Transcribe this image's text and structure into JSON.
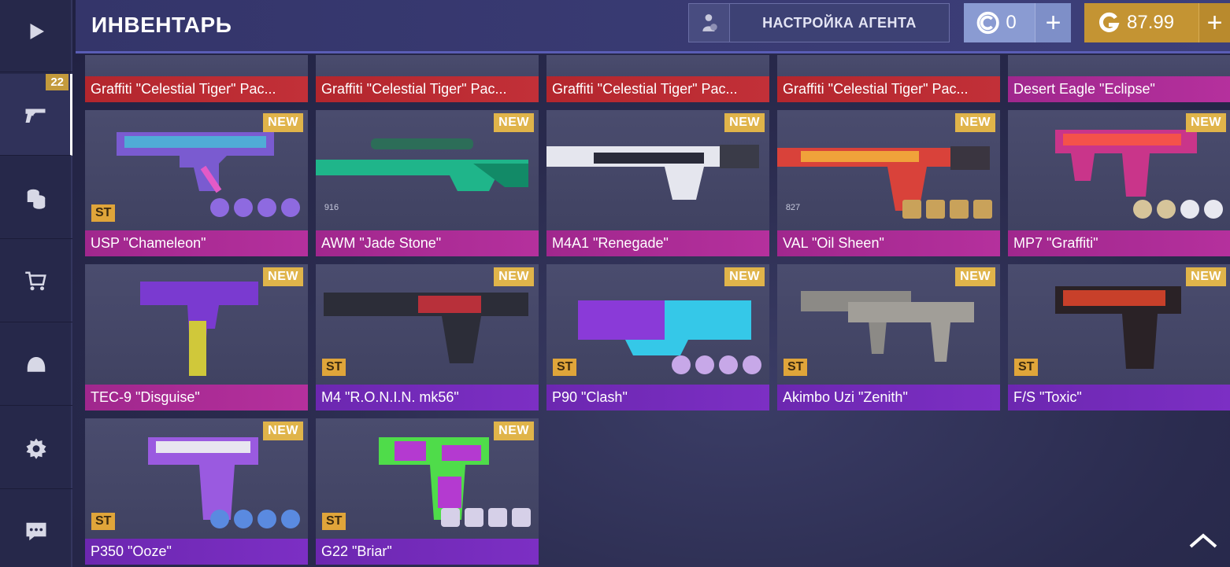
{
  "header": {
    "title": "ИНВЕНТАРЬ",
    "agent_button": "НАСТРОЙКА АГЕНТА",
    "credits": "0",
    "gold": "87.99",
    "plus": "+"
  },
  "sidebar": {
    "inventory_count": "22",
    "items": [
      "play-icon",
      "pistol-icon",
      "coins-icon",
      "cart-icon",
      "helmet-icon",
      "gear-icon",
      "chat-icon"
    ]
  },
  "badges": {
    "new": "NEW",
    "st": "ST"
  },
  "colors": {
    "red": "#b3262d",
    "pink": "#a0278d",
    "purple": "#6c27b0",
    "gold": "#c49433",
    "credit": "#8a9bd2"
  },
  "row0": [
    {
      "name": "Graffiti \"Celestial Tiger\" Pac...",
      "color": "red"
    },
    {
      "name": "Graffiti \"Celestial Tiger\" Pac...",
      "color": "red"
    },
    {
      "name": "Graffiti \"Celestial Tiger\" Pac...",
      "color": "red"
    },
    {
      "name": "Graffiti \"Celestial Tiger\" Pac...",
      "color": "red"
    },
    {
      "name": "Desert Eagle \"Eclipse\"",
      "color": "pink"
    }
  ],
  "row1": [
    {
      "name": "USP \"Chameleon\"",
      "color": "pink",
      "st": true
    },
    {
      "name": "AWM \"Jade Stone\"",
      "color": "pink",
      "wear": "916"
    },
    {
      "name": "M4A1 \"Renegade\"",
      "color": "pink"
    },
    {
      "name": "VAL \"Oil Sheen\"",
      "color": "pink",
      "wear": "827"
    },
    {
      "name": "MP7 \"Graffiti\"",
      "color": "pink"
    }
  ],
  "row2": [
    {
      "name": "TEC-9 \"Disguise\"",
      "color": "pink"
    },
    {
      "name": "M4 \"R.O.N.I.N. mk56\"",
      "color": "purple",
      "st": true
    },
    {
      "name": "P90 \"Clash\"",
      "color": "purple",
      "st": true
    },
    {
      "name": "Akimbo Uzi \"Zenith\"",
      "color": "purple",
      "st": true
    },
    {
      "name": "F/S \"Toxic\"",
      "color": "purple",
      "st": true
    }
  ],
  "row3": [
    {
      "name": "P350 \"Ooze\"",
      "color": "purple",
      "st": true
    },
    {
      "name": "G22 \"Briar\"",
      "color": "purple",
      "st": true
    }
  ]
}
